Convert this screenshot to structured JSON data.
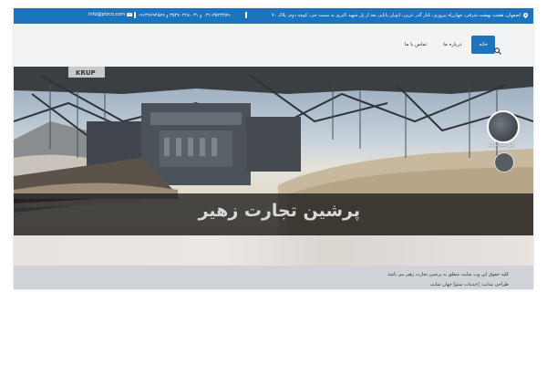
{
  "topbar": {
    "address": "اصفهان، هشت بهشت شرقی، چهارراه پیروزی، کنار گذر عربی، اتوبان بابایی بعد از پل شهید اکبری به سمت جی، کوچه دوم، پلاک ۷۰",
    "phones": "۰۳۱-۳۵۲۳۲۵۹۰ و ۰۳۱-۳۵۲۷۰۲۲۸ و ۰۹۱۳۹۶۹۲۵۸۹",
    "email": "info@ptzco.com"
  },
  "nav": {
    "items": [
      {
        "label": "خانه",
        "active": true
      },
      {
        "label": "درباره ما",
        "active": false
      },
      {
        "label": "تماس با ما",
        "active": false
      }
    ]
  },
  "hero": {
    "title": "پرشین تجارت زهیر",
    "thumb_label": "این تجارت به"
  },
  "footer": {
    "copyright": "کلیه حقوق این وب سایت متعلق به پرشین تجارت زهیر می باشد",
    "credit": "طراحی سایت: [خدمات سئو] جهان سایت"
  },
  "colors": {
    "accent": "#1e73be",
    "header_bg": "#f1f3f5",
    "footer_bg": "#cfd2d6"
  }
}
